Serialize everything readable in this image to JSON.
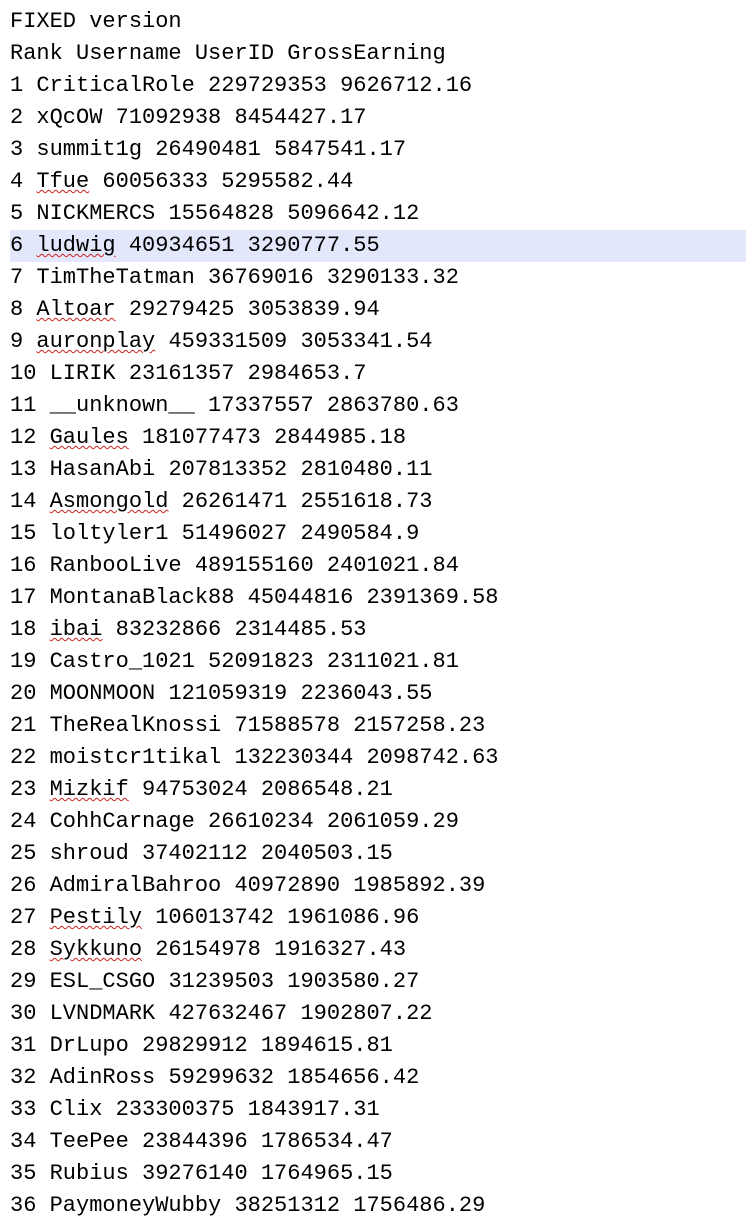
{
  "title": "FIXED version",
  "header": {
    "rank": "Rank",
    "username": "Username",
    "userid": "UserID",
    "gross": "GrossEarning"
  },
  "highlight_rank": 6,
  "spelled_usernames": [
    "Tfue",
    "ludwig",
    "Altoar",
    "auronplay",
    "Gaules",
    "Asmongold",
    "ibai",
    "Mizkif",
    "Pestily",
    "Sykkuno"
  ],
  "rows": [
    {
      "rank": 1,
      "username": "CriticalRole",
      "userid": "229729353",
      "gross": "9626712.16"
    },
    {
      "rank": 2,
      "username": "xQcOW",
      "userid": "71092938",
      "gross": "8454427.17"
    },
    {
      "rank": 3,
      "username": "summit1g",
      "userid": "26490481",
      "gross": "5847541.17"
    },
    {
      "rank": 4,
      "username": "Tfue",
      "userid": "60056333",
      "gross": "5295582.44"
    },
    {
      "rank": 5,
      "username": "NICKMERCS",
      "userid": "15564828",
      "gross": "5096642.12"
    },
    {
      "rank": 6,
      "username": "ludwig",
      "userid": "40934651",
      "gross": "3290777.55"
    },
    {
      "rank": 7,
      "username": "TimTheTatman",
      "userid": "36769016",
      "gross": "3290133.32"
    },
    {
      "rank": 8,
      "username": "Altoar",
      "userid": "29279425",
      "gross": "3053839.94"
    },
    {
      "rank": 9,
      "username": "auronplay",
      "userid": "459331509",
      "gross": "3053341.54"
    },
    {
      "rank": 10,
      "username": "LIRIK",
      "userid": "23161357",
      "gross": "2984653.7"
    },
    {
      "rank": 11,
      "username": "__unknown__",
      "userid": "17337557",
      "gross": "2863780.63"
    },
    {
      "rank": 12,
      "username": "Gaules",
      "userid": "181077473",
      "gross": "2844985.18"
    },
    {
      "rank": 13,
      "username": "HasanAbi",
      "userid": "207813352",
      "gross": "2810480.11"
    },
    {
      "rank": 14,
      "username": "Asmongold",
      "userid": "26261471",
      "gross": "2551618.73"
    },
    {
      "rank": 15,
      "username": "loltyler1",
      "userid": "51496027",
      "gross": "2490584.9"
    },
    {
      "rank": 16,
      "username": "RanbooLive",
      "userid": "489155160",
      "gross": "2401021.84"
    },
    {
      "rank": 17,
      "username": "MontanaBlack88",
      "userid": "45044816",
      "gross": "2391369.58"
    },
    {
      "rank": 18,
      "username": "ibai",
      "userid": "83232866",
      "gross": "2314485.53"
    },
    {
      "rank": 19,
      "username": "Castro_1021",
      "userid": "52091823",
      "gross": "2311021.81"
    },
    {
      "rank": 20,
      "username": "MOONMOON",
      "userid": "121059319",
      "gross": "2236043.55"
    },
    {
      "rank": 21,
      "username": "TheRealKnossi",
      "userid": "71588578",
      "gross": "2157258.23"
    },
    {
      "rank": 22,
      "username": "moistcr1tikal",
      "userid": "132230344",
      "gross": "2098742.63"
    },
    {
      "rank": 23,
      "username": "Mizkif",
      "userid": "94753024",
      "gross": "2086548.21"
    },
    {
      "rank": 24,
      "username": "CohhCarnage",
      "userid": "26610234",
      "gross": "2061059.29"
    },
    {
      "rank": 25,
      "username": "shroud",
      "userid": "37402112",
      "gross": "2040503.15"
    },
    {
      "rank": 26,
      "username": "AdmiralBahroo",
      "userid": "40972890",
      "gross": "1985892.39"
    },
    {
      "rank": 27,
      "username": "Pestily",
      "userid": "106013742",
      "gross": "1961086.96"
    },
    {
      "rank": 28,
      "username": "Sykkuno",
      "userid": "26154978",
      "gross": "1916327.43"
    },
    {
      "rank": 29,
      "username": "ESL_CSGO",
      "userid": "31239503",
      "gross": "1903580.27"
    },
    {
      "rank": 30,
      "username": "LVNDMARK",
      "userid": "427632467",
      "gross": "1902807.22"
    },
    {
      "rank": 31,
      "username": "DrLupo",
      "userid": "29829912",
      "gross": "1894615.81"
    },
    {
      "rank": 32,
      "username": "AdinRoss",
      "userid": "59299632",
      "gross": "1854656.42"
    },
    {
      "rank": 33,
      "username": "Clix",
      "userid": "233300375",
      "gross": "1843917.31"
    },
    {
      "rank": 34,
      "username": "TeePee",
      "userid": "23844396",
      "gross": "1786534.47"
    },
    {
      "rank": 35,
      "username": "Rubius",
      "userid": "39276140",
      "gross": "1764965.15"
    },
    {
      "rank": 36,
      "username": "PaymoneyWubby",
      "userid": "38251312",
      "gross": "1756486.29"
    }
  ]
}
